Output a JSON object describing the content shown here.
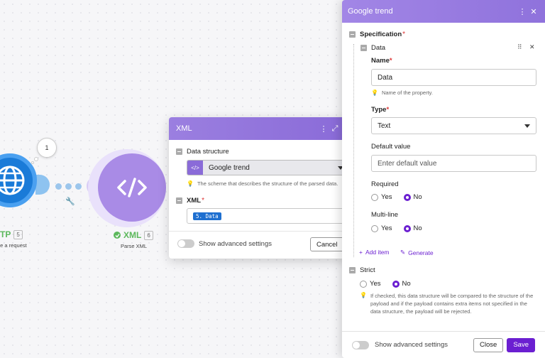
{
  "canvas": {
    "bubble_count": "1",
    "http_module": {
      "name": "HTTP",
      "count": "5",
      "subtitle": "Make a request"
    },
    "xml_module": {
      "name": "XML",
      "count": "6",
      "subtitle": "Parse XML"
    }
  },
  "xml_dialog": {
    "title": "XML",
    "data_structure_label": "Data structure",
    "data_structure_value": "Google trend",
    "data_structure_hint": "The scheme that describes the structure of the parsed data.",
    "xml_label": "XML",
    "xml_token": "5. Data",
    "advanced_label": "Show advanced settings",
    "cancel_label": "Cancel"
  },
  "google_trend_panel": {
    "title": "Google trend",
    "specification_label": "Specification",
    "data_item_label": "Data",
    "name_label": "Name",
    "name_value": "Data",
    "name_hint": "Name of the property.",
    "type_label": "Type",
    "type_value": "Text",
    "default_value_label": "Default value",
    "default_value_placeholder": "Enter default value",
    "required_label": "Required",
    "multiline_label": "Multi-line",
    "yes_label": "Yes",
    "no_label": "No",
    "add_item_label": "Add item",
    "generate_label": "Generate",
    "strict_label": "Strict",
    "strict_hint": "If checked, this data structure will be compared to the structure of the payload and if the payload contains extra items not specified in the data structure, the payload will be rejected.",
    "advanced_label": "Show advanced settings",
    "close_label": "Close",
    "save_label": "Save"
  },
  "colors": {
    "accent": "#6b1fd1",
    "header_purple": "#9b7fe0",
    "http_blue": "#1a7bd8",
    "xml_purple": "#a98be6",
    "token_blue": "#1e6fd0",
    "success_green": "#5cb85c"
  }
}
